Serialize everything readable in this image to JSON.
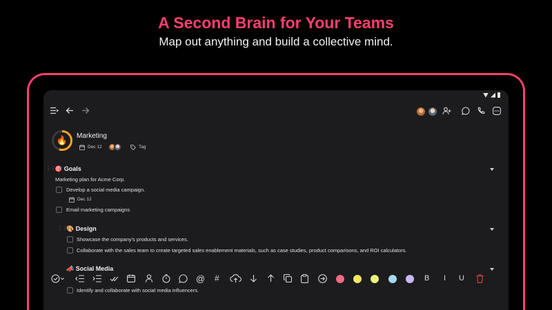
{
  "promo": {
    "headline": "A Second Brain for Your Teams",
    "subhead": "Map out anything and build a collective mind."
  },
  "topbar": {
    "icons": [
      "menu-icon",
      "back-arrow-icon",
      "forward-arrow-icon",
      "avatar",
      "avatar",
      "add-user-icon",
      "chat-icon",
      "phone-icon",
      "more-icon"
    ]
  },
  "note": {
    "emoji": "🔥",
    "title": "Marketing",
    "date": "Dec 12",
    "tag": "Tag"
  },
  "sections": {
    "goals": {
      "emoji": "🎯",
      "title": "Goals",
      "description": "Marketing plan for Acme Corp.",
      "tasks": [
        {
          "text": "Develop a social media campaign.",
          "date": "Dec 12"
        },
        {
          "text": "Email marketing campaigns"
        }
      ]
    },
    "design": {
      "emoji": "🎨",
      "title": "Design",
      "tasks": [
        {
          "text": "Showcase the company's products and services."
        },
        {
          "text": "Collaborate with the sales team to create targeted sales enablement materials, such as case studies, product comparisons, and ROI calculators."
        }
      ]
    },
    "social": {
      "emoji": "📣",
      "title": "Social Media",
      "tasks": [
        {
          "text": "Identify and collaborate with social media influencers."
        }
      ]
    }
  },
  "format_toolbar": {
    "bold": "B",
    "italic": "I",
    "underline": "U",
    "colors": [
      "#f06a82",
      "#f5e663",
      "#e9f27a",
      "#a8d8f0",
      "#c9b8f2"
    ]
  },
  "colors": {
    "accent": "#ff3f6f",
    "background": "#000000",
    "surface": "#1c1c1e",
    "delete": "#e5483a"
  }
}
